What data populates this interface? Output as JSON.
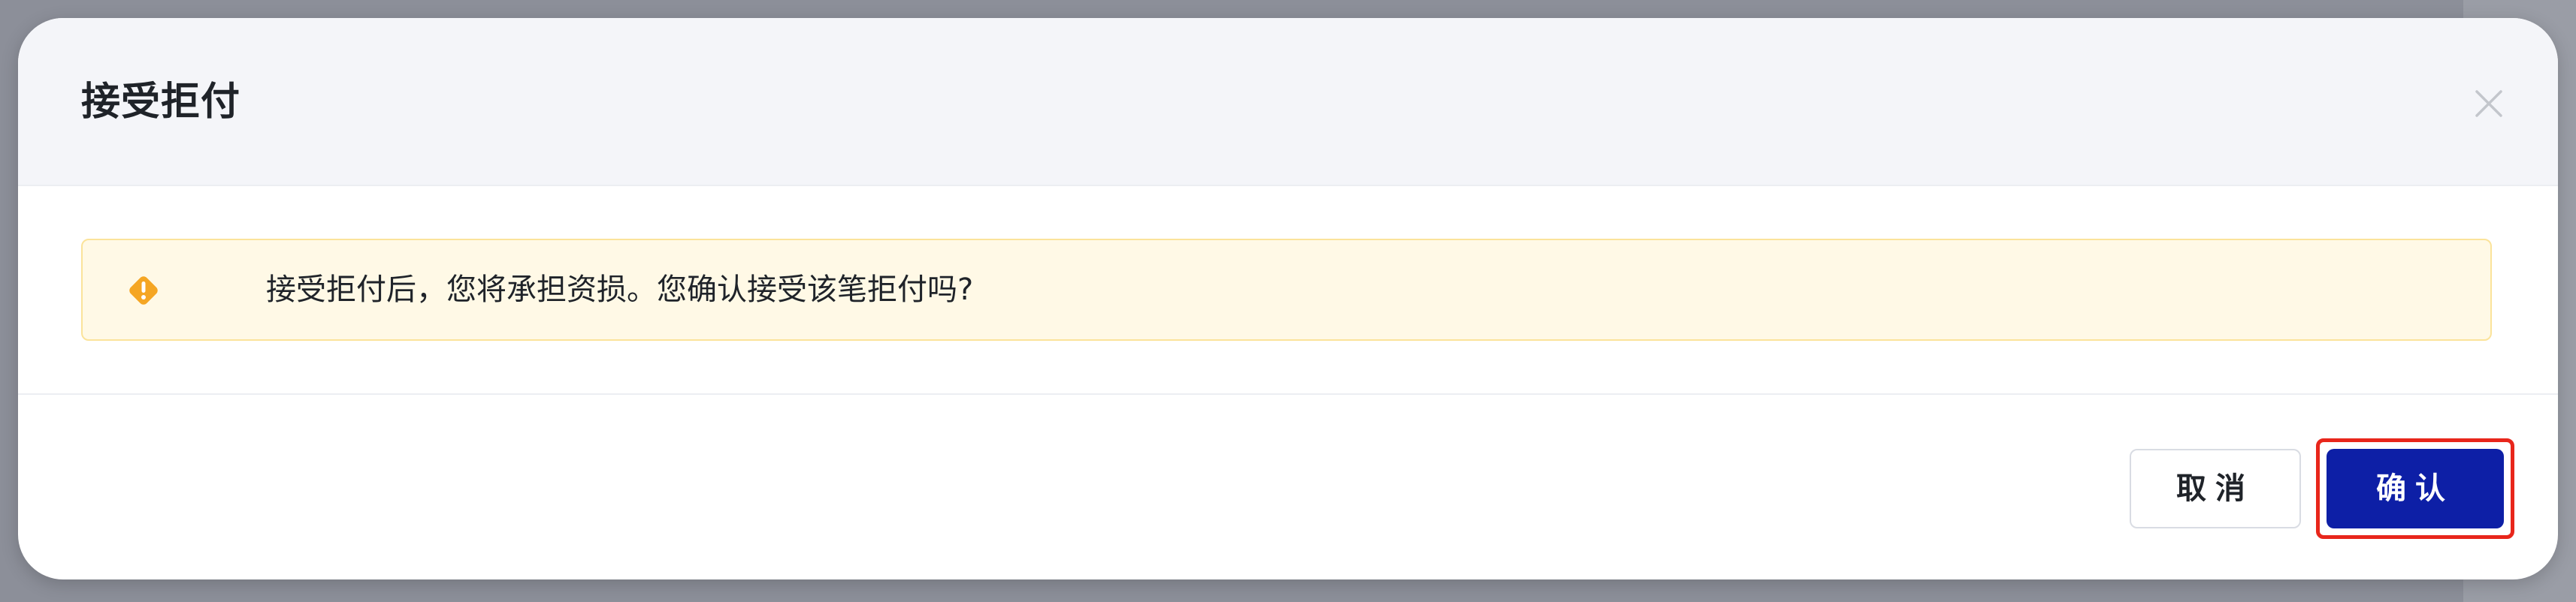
{
  "dialog": {
    "title": "接受拒付",
    "close_icon": "close-icon"
  },
  "alert": {
    "icon": "warning-diamond-icon",
    "message": "接受拒付后，您将承担资损。您确认接受该笔拒付吗?",
    "colors": {
      "background": "#fff9e6",
      "border": "#fbe39a",
      "icon": "#f5a623"
    }
  },
  "footer": {
    "cancel_label": "取消",
    "confirm_label": "确认"
  },
  "colors": {
    "primary": "#0d1fa6",
    "highlight_outline": "#e8261b"
  }
}
